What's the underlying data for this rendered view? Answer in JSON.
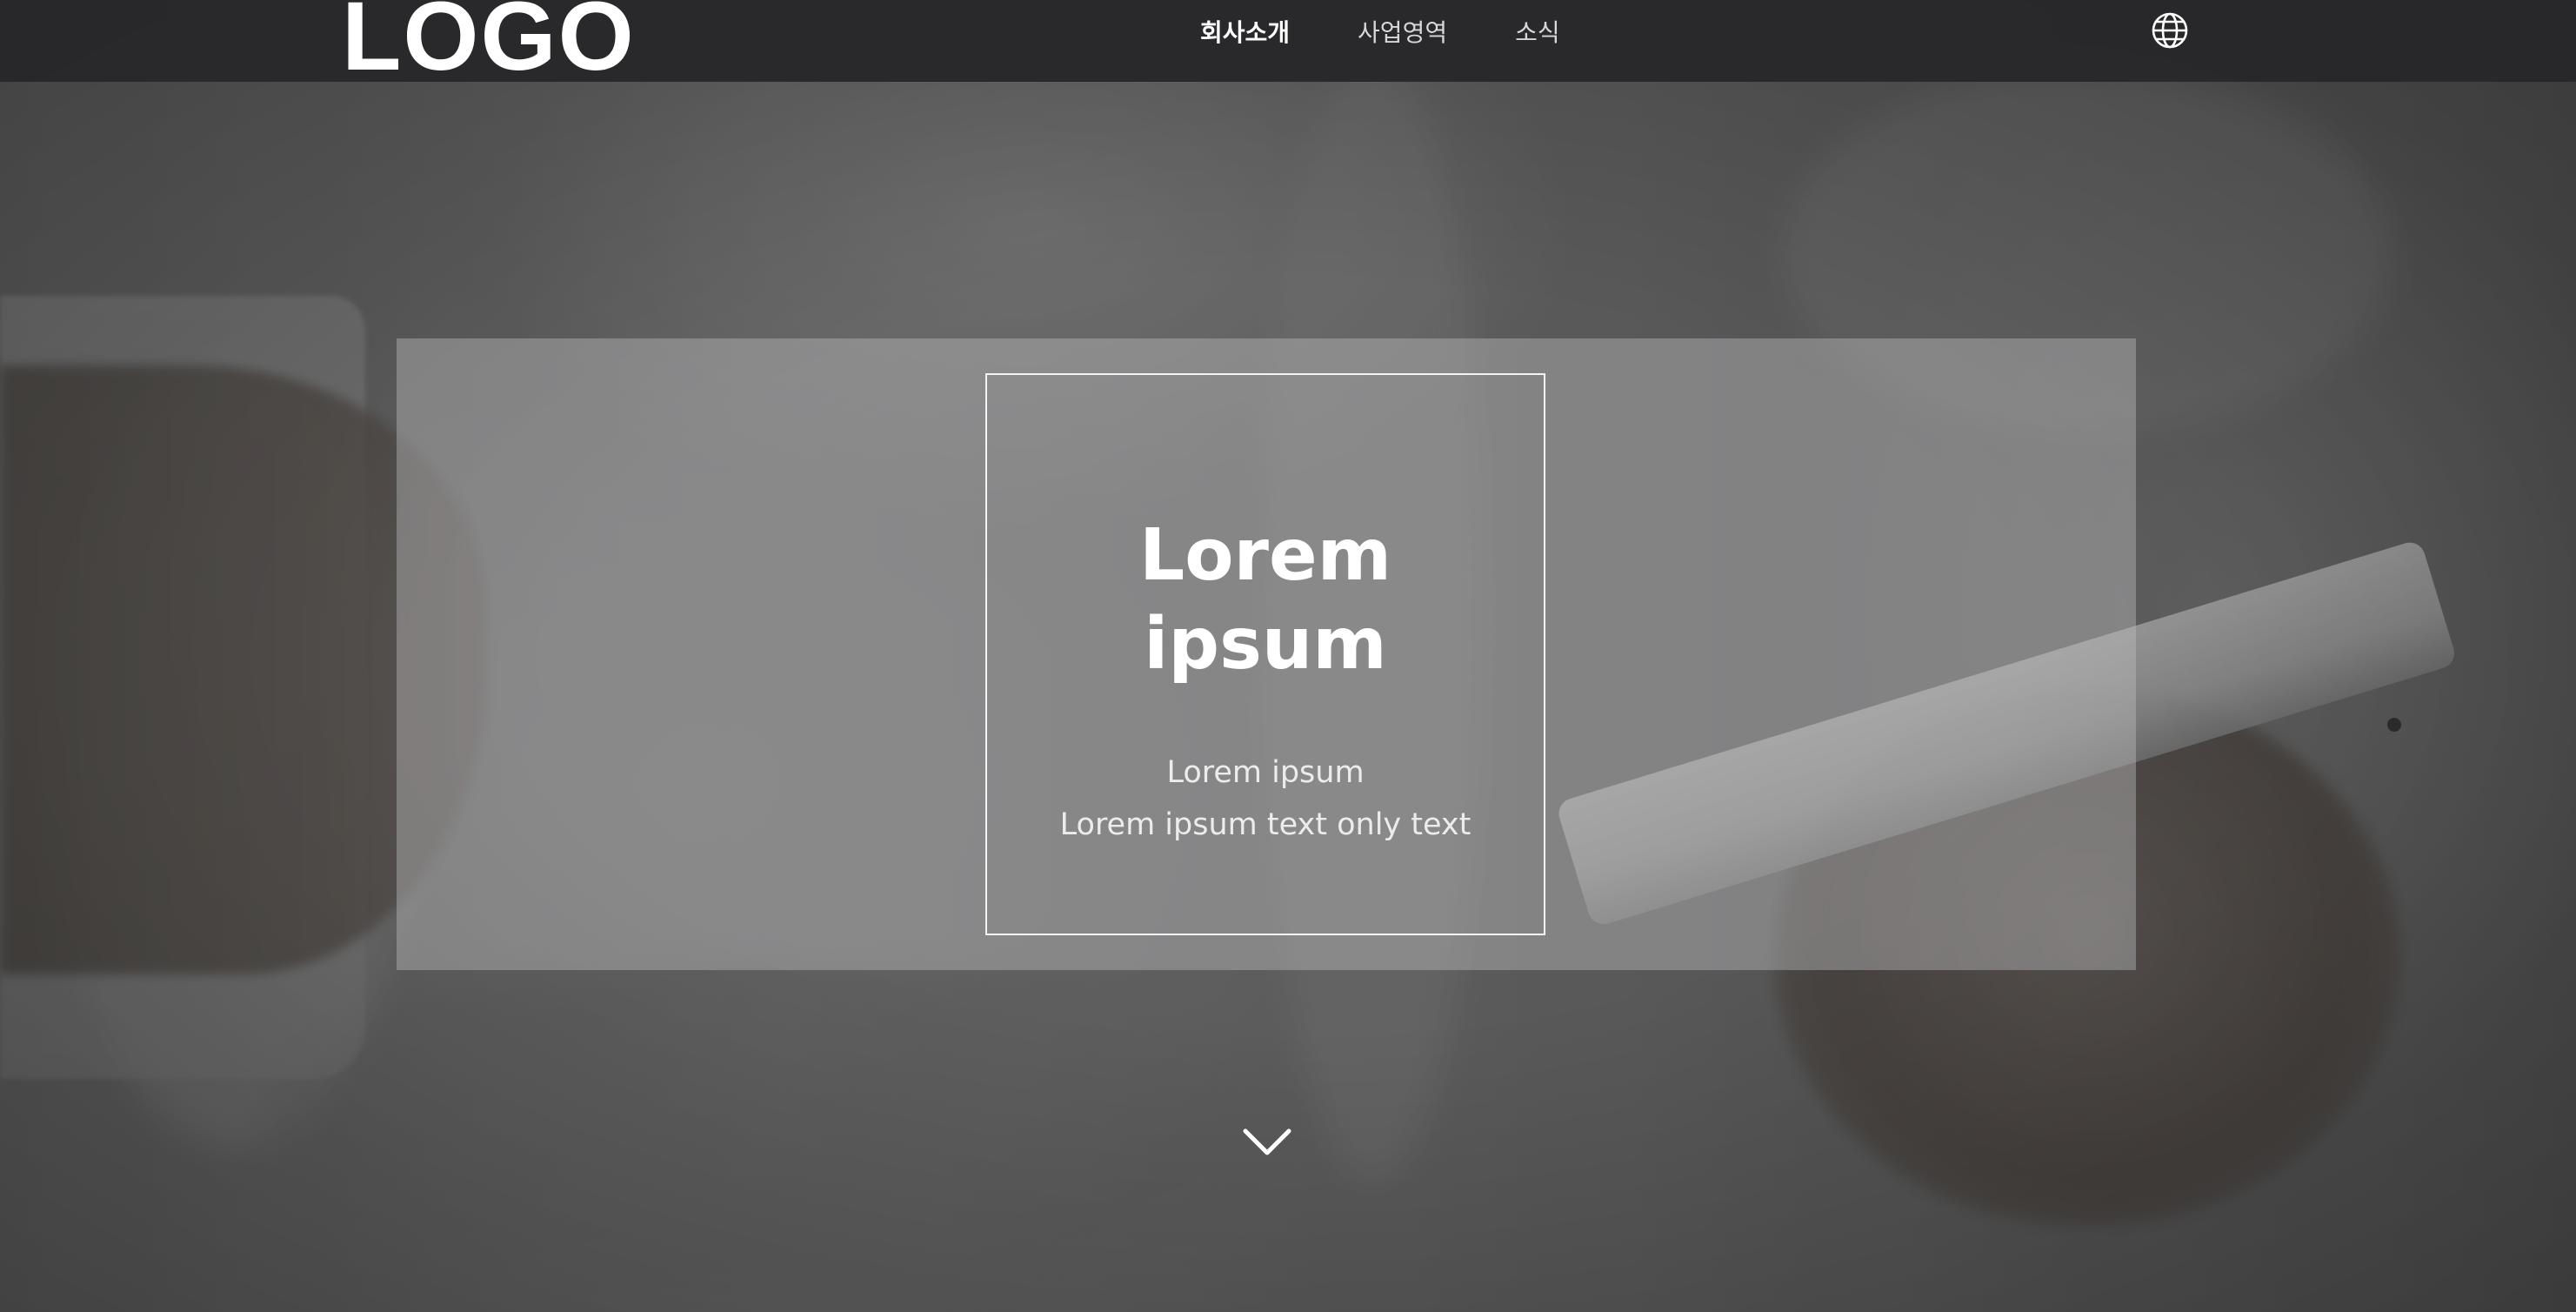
{
  "header": {
    "logo_text": "LOGO",
    "nav": [
      {
        "label": "회사소개",
        "active": true
      },
      {
        "label": "사업영역",
        "active": false
      },
      {
        "label": "소식",
        "active": false
      }
    ],
    "language_icon": "globe-icon"
  },
  "hero": {
    "title_line1": "Lorem",
    "title_line2": "ipsum",
    "subtitle_line1": "Lorem ipsum",
    "subtitle_line2": "Lorem ipsum text only text",
    "scroll_icon": "chevron-down-icon"
  },
  "colors": {
    "header_bg": "#28282a",
    "text_primary": "#ffffff",
    "nav_inactive": "#d8d8d8"
  }
}
